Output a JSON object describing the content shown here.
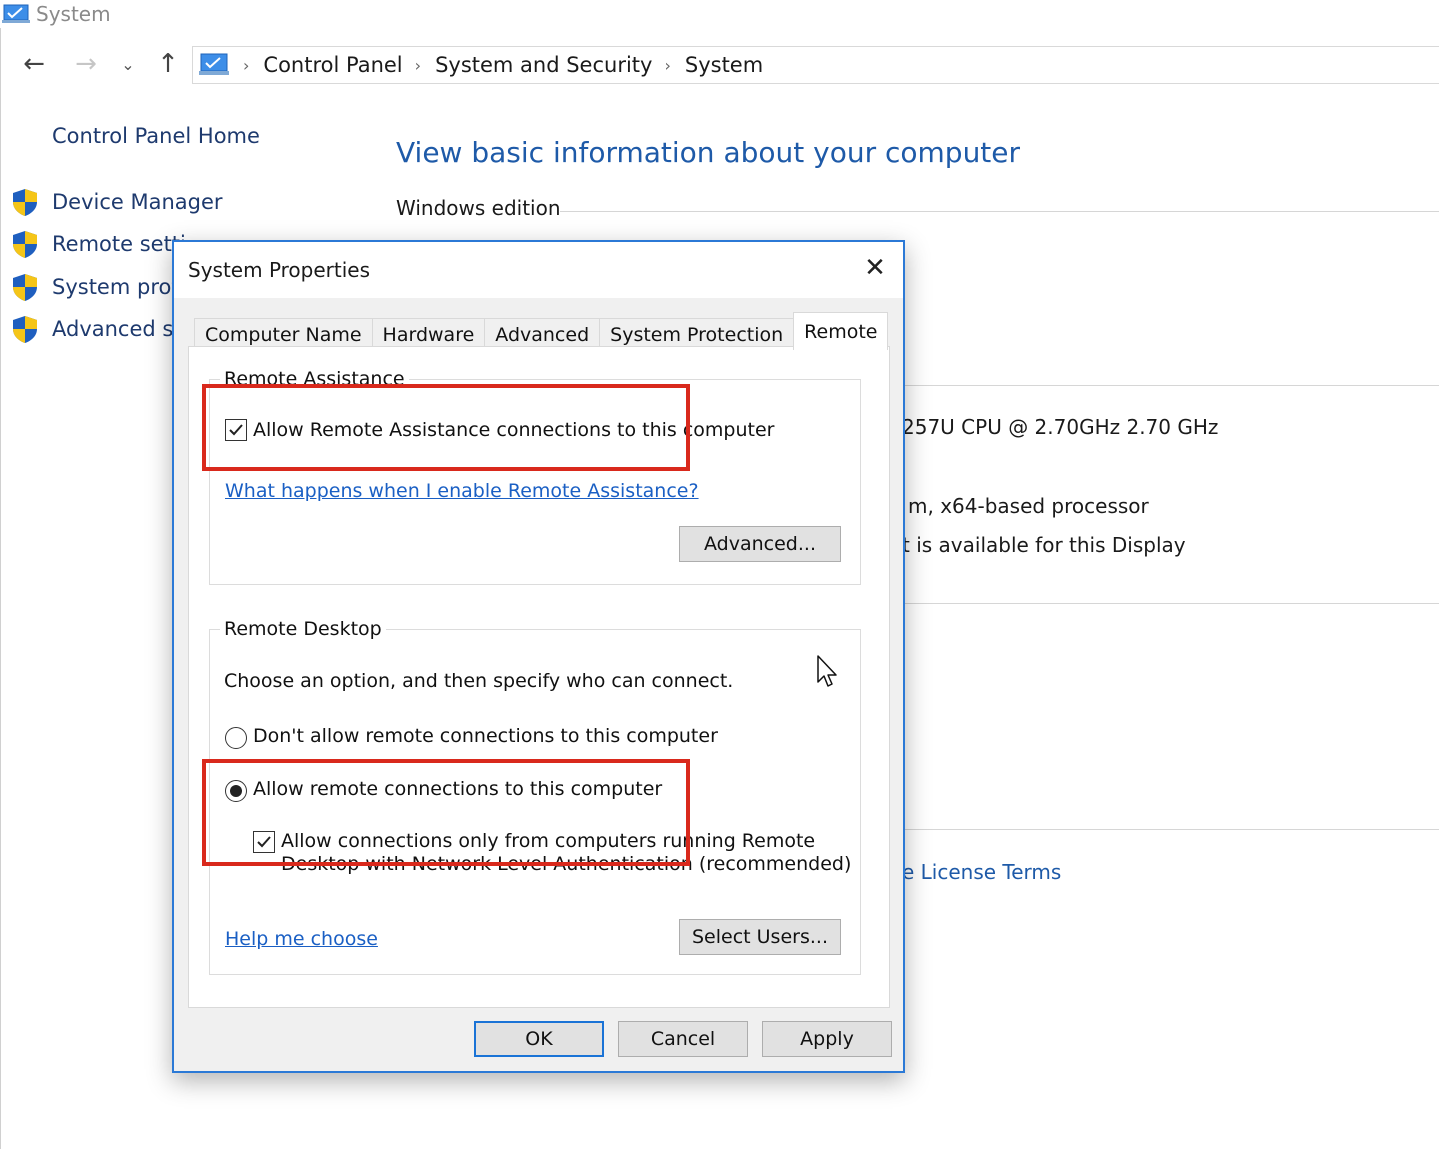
{
  "window": {
    "title": "System",
    "breadcrumb": [
      "Control Panel",
      "System and Security",
      "System"
    ]
  },
  "sidebar": {
    "home": "Control Panel Home",
    "items": [
      {
        "label": "Device Manager"
      },
      {
        "label": "Remote setti"
      },
      {
        "label": "System prote"
      },
      {
        "label": "Advanced sy"
      }
    ]
  },
  "main": {
    "heading": "View basic information about your computer",
    "windows_edition": "Windows edition",
    "processor": "257U CPU @ 2.70GHz   2.70 GHz",
    "system_type": "m, x64-based processor",
    "pen_touch": "t is available for this Display",
    "license_link": "e License Terms"
  },
  "dialog": {
    "title": "System Properties",
    "tabs": [
      {
        "label": "Computer Name"
      },
      {
        "label": "Hardware"
      },
      {
        "label": "Advanced"
      },
      {
        "label": "System Protection"
      },
      {
        "label": "Remote",
        "active": true
      }
    ],
    "remote_assistance": {
      "legend": "Remote Assistance",
      "checkbox_label": "Allow Remote Assistance connections to this computer",
      "checked": true,
      "help_link": "What happens when I enable Remote Assistance?",
      "advanced_button": "Advanced..."
    },
    "remote_desktop": {
      "legend": "Remote Desktop",
      "instruction": "Choose an option, and then specify who can connect.",
      "option_dont_allow": "Don't allow remote connections to this computer",
      "option_allow": "Allow remote connections to this computer",
      "selected_option": "allow",
      "nla_line1": "Allow connections only from computers running Remote",
      "nla_line2": "Desktop with Network Level Authentication (recommended)",
      "nla_checked": true,
      "help_link": "Help me choose",
      "select_users_button": "Select Users..."
    },
    "buttons": {
      "ok": "OK",
      "cancel": "Cancel",
      "apply": "Apply"
    }
  },
  "colors": {
    "highlight_box": "#d9291c",
    "dialog_border": "#2b79d6",
    "link": "#1a5fc4",
    "heading": "#1e5aa8"
  }
}
